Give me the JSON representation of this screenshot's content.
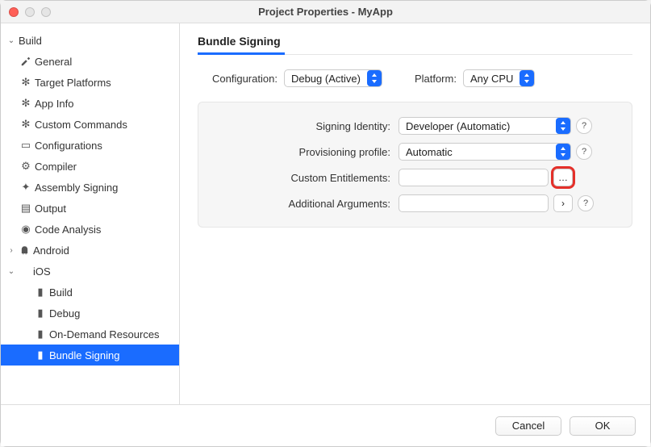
{
  "window": {
    "title": "Project Properties - MyApp"
  },
  "sidebar": {
    "root": {
      "label": "Build",
      "expanded": true,
      "items": [
        {
          "label": "General",
          "icon": "hammer"
        },
        {
          "label": "Target Platforms",
          "icon": "gear"
        },
        {
          "label": "App Info",
          "icon": "gear"
        },
        {
          "label": "Custom Commands",
          "icon": "gear"
        },
        {
          "label": "Configurations",
          "icon": "stack"
        },
        {
          "label": "Compiler",
          "icon": "compiler"
        },
        {
          "label": "Assembly Signing",
          "icon": "signing"
        },
        {
          "label": "Output",
          "icon": "output"
        },
        {
          "label": "Code Analysis",
          "icon": "analysis"
        },
        {
          "label": "Android",
          "icon": "android",
          "expanded": false
        },
        {
          "label": "iOS",
          "icon": "apple",
          "expanded": true,
          "children": [
            {
              "label": "Build",
              "icon": "page"
            },
            {
              "label": "Debug",
              "icon": "page"
            },
            {
              "label": "On-Demand Resources",
              "icon": "page"
            },
            {
              "label": "Bundle Signing",
              "icon": "page",
              "selected": true
            }
          ]
        }
      ]
    }
  },
  "page": {
    "title": "Bundle Signing",
    "configuration": {
      "label": "Configuration:",
      "value": "Debug (Active)"
    },
    "platform": {
      "label": "Platform:",
      "value": "Any CPU"
    },
    "form": {
      "signing_identity": {
        "label": "Signing Identity:",
        "value": "Developer (Automatic)"
      },
      "provisioning_profile": {
        "label": "Provisioning profile:",
        "value": "Automatic"
      },
      "custom_entitlements": {
        "label": "Custom Entitlements:",
        "value": "",
        "browse": "…"
      },
      "additional_arguments": {
        "label": "Additional Arguments:",
        "value": "",
        "expand": "›"
      }
    }
  },
  "footer": {
    "cancel": "Cancel",
    "ok": "OK"
  }
}
